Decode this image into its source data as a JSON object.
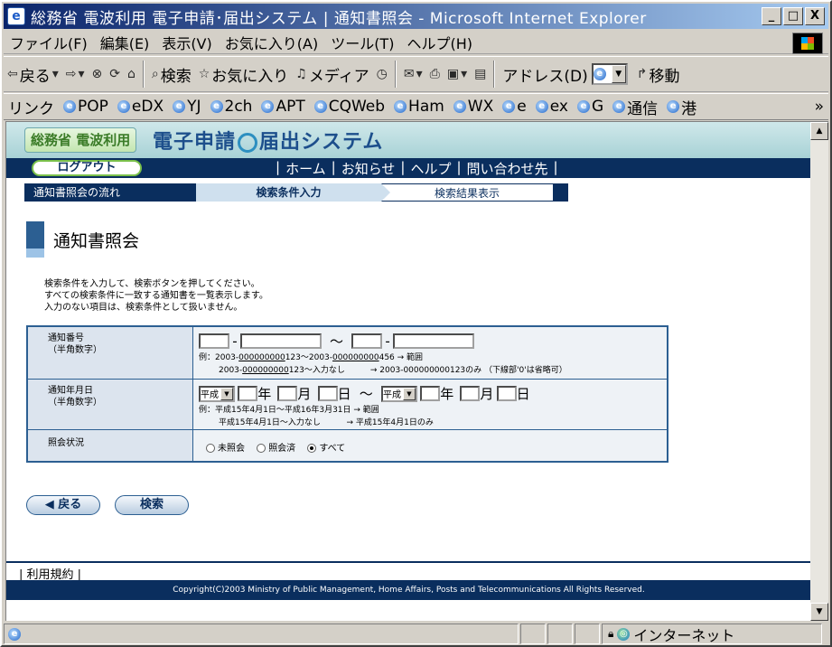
{
  "window": {
    "title": "総務省 電波利用 電子申請･届出システム | 通知書照会 - Microsoft Internet Explorer",
    "min": "_",
    "max": "□",
    "close": "X"
  },
  "menu": [
    "ファイル(F)",
    "編集(E)",
    "表示(V)",
    "お気に入り(A)",
    "ツール(T)",
    "ヘルプ(H)"
  ],
  "toolbar": {
    "back": "戻る",
    "search": "検索",
    "favorites": "お気に入り",
    "media": "メディア",
    "address_label": "アドレス(D)",
    "go": "移動"
  },
  "links": {
    "label": "リンク",
    "items": [
      "POP",
      "eDX",
      "YJ",
      "2ch",
      "APT",
      "CQWeb",
      "Ham",
      "WX",
      "e",
      "ex",
      "G",
      "通信",
      "港"
    ],
    "more": "»"
  },
  "site": {
    "brand_left": "総務省 電波利用",
    "brand_right_a": "電子申請",
    "brand_right_b": "届出システム",
    "logout": "ログアウト",
    "nav": [
      "ホーム",
      "お知らせ",
      "ヘルプ",
      "問い合わせ先"
    ]
  },
  "steps": {
    "flow": "通知書照会の流れ",
    "current": "検索条件入力",
    "next": "検索結果表示"
  },
  "page_title": "通知書照会",
  "instructions": [
    "検索条件を入力して、検索ボタンを押してください。",
    "すべての検索条件に一致する通知書を一覧表示します。",
    "入力のない項目は、検索条件として扱いません。"
  ],
  "form": {
    "number": {
      "label": "通知番号",
      "sub": "（半角数字）",
      "dash": "-",
      "tilde": "～",
      "ex1_a": "例：2003-",
      "ex1_b": "000000000",
      "ex1_c": "123～2003-",
      "ex1_d": "000000000",
      "ex1_e": "456 → 範囲",
      "ex2_a": "2003-",
      "ex2_b": "000000000",
      "ex2_c": "123～入力なし",
      "ex2_d": "→ 2003-000000000123のみ （下線部'0'は省略可）"
    },
    "date": {
      "label": "通知年月日",
      "sub": "（半角数字）",
      "era": "平成",
      "year": "年",
      "month": "月",
      "day": "日",
      "tilde": "～",
      "ex1": "例：平成15年4月1日～平成16年3月31日 → 範囲",
      "ex2": "平成15年4月1日～入力なし          → 平成15年4月1日のみ"
    },
    "status": {
      "label": "照会状況",
      "options": [
        "未照会",
        "照会済",
        "すべて"
      ],
      "selected": "すべて"
    }
  },
  "buttons": {
    "back": "◀ 戻る",
    "search": "検索"
  },
  "footer": {
    "terms": "利用規約",
    "copyright": "Copyright(C)2003 Ministry of Public Management, Home Affairs, Posts and Telecommunications All Rights Reserved."
  },
  "statusbar": {
    "zone": "インターネット"
  }
}
